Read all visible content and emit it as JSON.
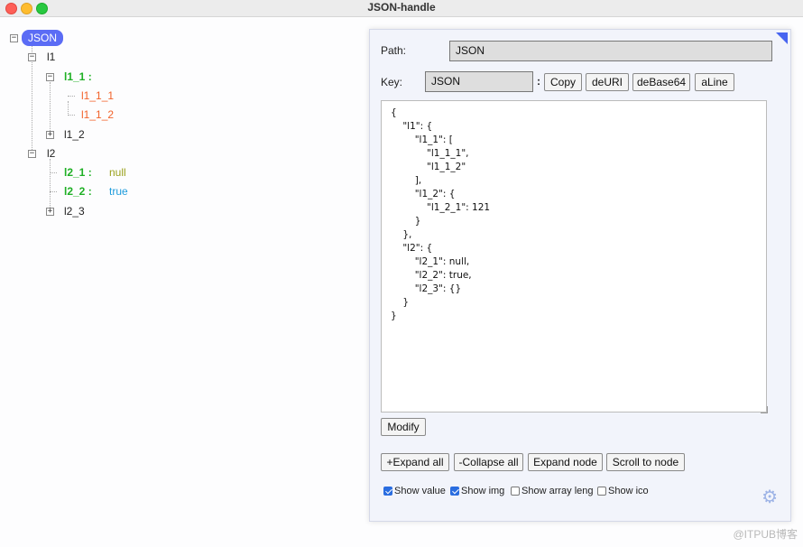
{
  "window": {
    "title": "JSON-handle"
  },
  "tree": {
    "root": "JSON",
    "l1": "l1",
    "l1_1": "l1_1 :",
    "l1_1_1": "l1_1_1",
    "l1_1_2": "l1_1_2",
    "l1_2": "l1_2",
    "l2": "l2",
    "l2_1_key": "l2_1 :",
    "l2_1_val": "null",
    "l2_2_key": "l2_2 :",
    "l2_2_val": "true",
    "l2_3": "l2_3"
  },
  "panel": {
    "path_label": "Path:",
    "path_value": "JSON",
    "key_label": "Key:",
    "key_value": "JSON",
    "key_sep": ":",
    "buttons": {
      "copy": "Copy",
      "deuri": "deURI",
      "debase64": "deBase64",
      "aline": "aLine",
      "modify": "Modify",
      "expand_all": "+Expand all",
      "collapse_all": "-Collapse all",
      "expand_node": "Expand node",
      "scroll_to_node": "Scroll to node"
    },
    "editor_text": "{\n    \"l1\": {\n        \"l1_1\": [\n            \"l1_1_1\",\n            \"l1_1_2\"\n        ],\n        \"l1_2\": {\n            \"l1_2_1\": 121\n        }\n    },\n    \"l2\": {\n        \"l2_1\": null,\n        \"l2_2\": true,\n        \"l2_3\": {}\n    }\n}",
    "options": {
      "show_value": {
        "label": "Show value",
        "checked": true
      },
      "show_img": {
        "label": "Show img",
        "checked": true
      },
      "show_array_leng": {
        "label": "Show array leng",
        "checked": false
      },
      "show_ico": {
        "label": "Show ico",
        "checked": false
      }
    }
  },
  "watermark": "@ITPUB博客"
}
